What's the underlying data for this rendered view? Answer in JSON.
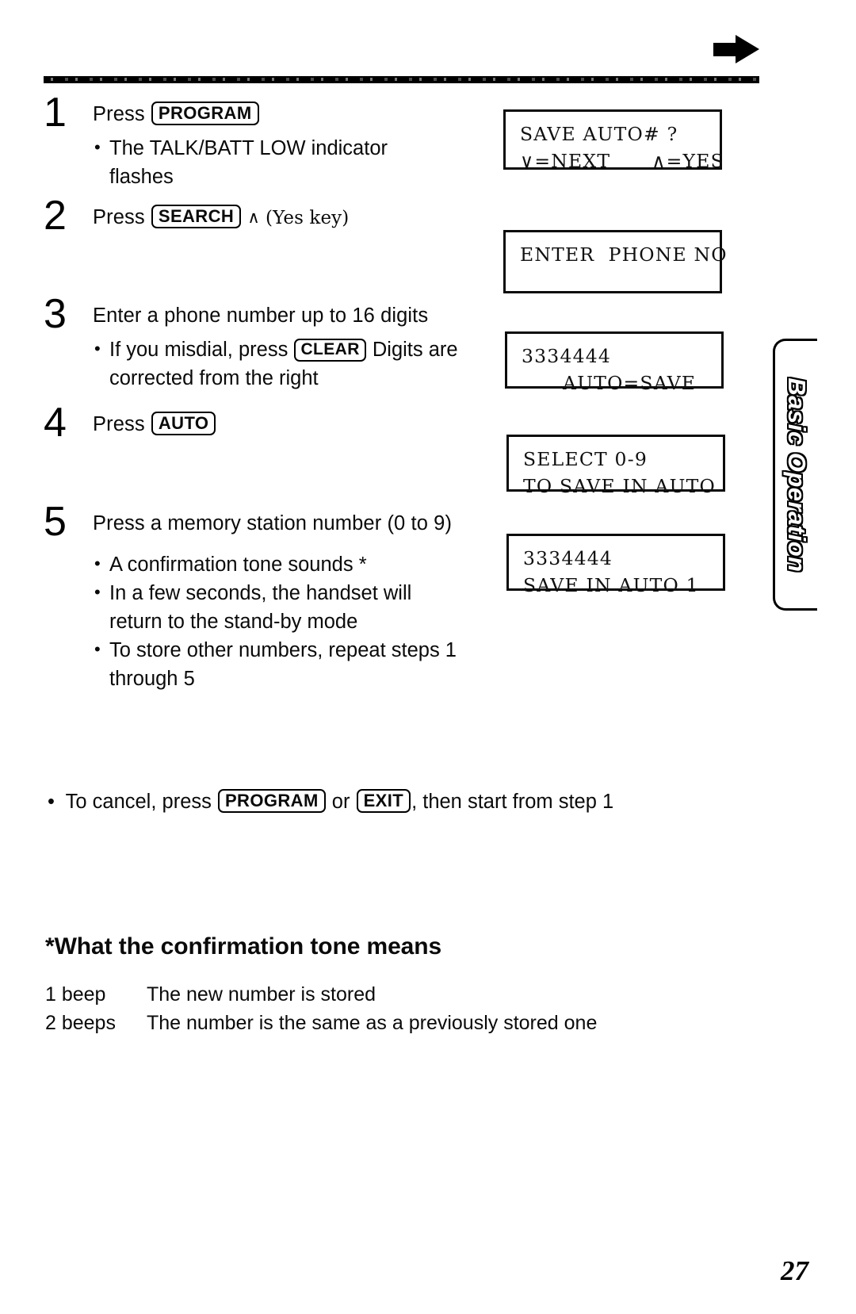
{
  "header": {
    "arrow_icon": "arrow-right-icon",
    "rule": "horizontal-rule"
  },
  "steps": [
    {
      "number": "1",
      "title_prefix": "Press ",
      "keys": [
        "PROGRAM"
      ],
      "title_suffix": "",
      "bullets": [
        {
          "lines": [
            "The TALK/BATT LOW indicator",
            "flashes"
          ]
        }
      ]
    },
    {
      "number": "2",
      "title_prefix": "Press ",
      "keys": [
        "SEARCH"
      ],
      "title_suffix": " ∧ (Yes key)",
      "bullets": []
    },
    {
      "number": "3",
      "title_prefix": "Enter a phone number up to 16 digits",
      "keys": [],
      "title_suffix": "",
      "bullets": [
        {
          "lines": [
            "If you misdial, press ",
            "CLEAR",
            " Digits are",
            "corrected from the right"
          ]
        }
      ]
    },
    {
      "number": "4",
      "title_prefix": "Press ",
      "keys": [
        "AUTO"
      ],
      "title_suffix": "",
      "bullets": []
    },
    {
      "number": "5",
      "title_prefix": "Press a memory station number (0 to 9)",
      "keys": [],
      "title_suffix": "",
      "bullets": [
        {
          "lines": [
            "A confirmation tone sounds *"
          ]
        },
        {
          "lines": [
            "In a few seconds, the handset will",
            "return to the stand-by mode"
          ]
        },
        {
          "lines": [
            "To store other numbers, repeat steps 1",
            "through 5"
          ]
        }
      ]
    }
  ],
  "step_text": {
    "s1_press": "Press",
    "s1_key": "PROGRAM",
    "s1_b1_l1": "The TALK/BATT LOW indicator",
    "s1_b1_l2": "flashes",
    "s2_press": "Press",
    "s2_key": "SEARCH",
    "s2_arrow": "∧",
    "s2_yeskey": "(Yes key)",
    "s3_title": "Enter a phone number up to 16 digits",
    "s3_b1_a": "If you misdial, press",
    "s3_b1_key": "CLEAR",
    "s3_b1_b": "Digits are",
    "s3_b1_l2": "corrected from the right",
    "s4_press": "Press",
    "s4_key": "AUTO",
    "s5_title": "Press a memory station number (0 to 9)",
    "s5_b1": "A confirmation tone sounds *",
    "s5_b2_l1": "In a few seconds, the handset will",
    "s5_b2_l2": "return to the stand-by mode",
    "s5_b3_l1": "To store other numbers, repeat steps 1",
    "s5_b3_l2": "through 5"
  },
  "displays": [
    {
      "id": "display-1",
      "line1": "SAVE AUTO# ?",
      "line2": "∨=NEXT      ∧=YES"
    },
    {
      "id": "display-2",
      "line1": "ENTER  PHONE NO",
      "line2": ""
    },
    {
      "id": "display-3",
      "line1": "3334444",
      "line2": "      AUTO=SAVE"
    },
    {
      "id": "display-4",
      "line1": "SELECT 0-9",
      "line2": "TO SAVE IN AUTO"
    },
    {
      "id": "display-5",
      "line1": "3334444",
      "line2": "SAVE IN AUTO 1"
    }
  ],
  "side_tab": {
    "label": "Basic Operation"
  },
  "cancel_note": {
    "part1": "To cancel, press",
    "key1": "PROGRAM",
    "part2": "or",
    "key2": "EXIT",
    "part3": ", then start from step 1"
  },
  "confirmation_section": {
    "heading": "*What the confirmation tone means",
    "rows": [
      {
        "label": "1 beep",
        "text": "The new number is stored"
      },
      {
        "label": "2 beeps",
        "text": "The number is the same as a previously stored one"
      }
    ]
  },
  "page_number": "27",
  "colors": {
    "ink": "#0a0a0a",
    "paper": "#ffffff"
  }
}
